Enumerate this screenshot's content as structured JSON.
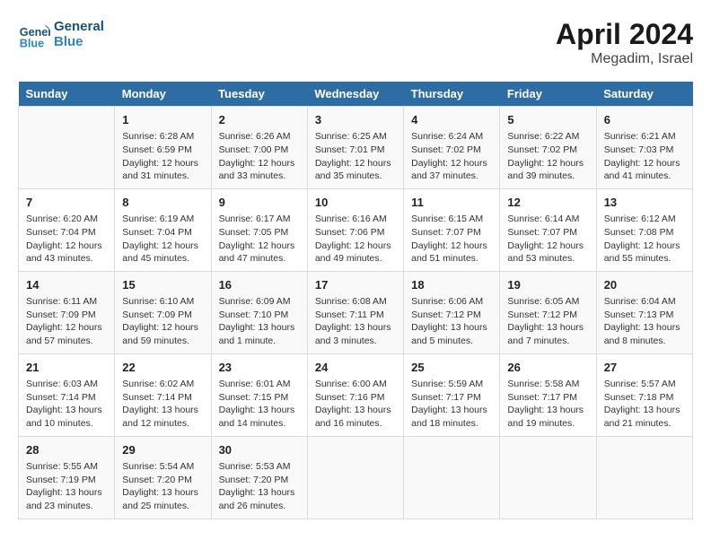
{
  "header": {
    "logo_line1": "General",
    "logo_line2": "Blue",
    "month": "April 2024",
    "location": "Megadim, Israel"
  },
  "days_of_week": [
    "Sunday",
    "Monday",
    "Tuesday",
    "Wednesday",
    "Thursday",
    "Friday",
    "Saturday"
  ],
  "weeks": [
    [
      {
        "day": "",
        "info": ""
      },
      {
        "day": "1",
        "info": "Sunrise: 6:28 AM\nSunset: 6:59 PM\nDaylight: 12 hours\nand 31 minutes."
      },
      {
        "day": "2",
        "info": "Sunrise: 6:26 AM\nSunset: 7:00 PM\nDaylight: 12 hours\nand 33 minutes."
      },
      {
        "day": "3",
        "info": "Sunrise: 6:25 AM\nSunset: 7:01 PM\nDaylight: 12 hours\nand 35 minutes."
      },
      {
        "day": "4",
        "info": "Sunrise: 6:24 AM\nSunset: 7:02 PM\nDaylight: 12 hours\nand 37 minutes."
      },
      {
        "day": "5",
        "info": "Sunrise: 6:22 AM\nSunset: 7:02 PM\nDaylight: 12 hours\nand 39 minutes."
      },
      {
        "day": "6",
        "info": "Sunrise: 6:21 AM\nSunset: 7:03 PM\nDaylight: 12 hours\nand 41 minutes."
      }
    ],
    [
      {
        "day": "7",
        "info": "Sunrise: 6:20 AM\nSunset: 7:04 PM\nDaylight: 12 hours\nand 43 minutes."
      },
      {
        "day": "8",
        "info": "Sunrise: 6:19 AM\nSunset: 7:04 PM\nDaylight: 12 hours\nand 45 minutes."
      },
      {
        "day": "9",
        "info": "Sunrise: 6:17 AM\nSunset: 7:05 PM\nDaylight: 12 hours\nand 47 minutes."
      },
      {
        "day": "10",
        "info": "Sunrise: 6:16 AM\nSunset: 7:06 PM\nDaylight: 12 hours\nand 49 minutes."
      },
      {
        "day": "11",
        "info": "Sunrise: 6:15 AM\nSunset: 7:07 PM\nDaylight: 12 hours\nand 51 minutes."
      },
      {
        "day": "12",
        "info": "Sunrise: 6:14 AM\nSunset: 7:07 PM\nDaylight: 12 hours\nand 53 minutes."
      },
      {
        "day": "13",
        "info": "Sunrise: 6:12 AM\nSunset: 7:08 PM\nDaylight: 12 hours\nand 55 minutes."
      }
    ],
    [
      {
        "day": "14",
        "info": "Sunrise: 6:11 AM\nSunset: 7:09 PM\nDaylight: 12 hours\nand 57 minutes."
      },
      {
        "day": "15",
        "info": "Sunrise: 6:10 AM\nSunset: 7:09 PM\nDaylight: 12 hours\nand 59 minutes."
      },
      {
        "day": "16",
        "info": "Sunrise: 6:09 AM\nSunset: 7:10 PM\nDaylight: 13 hours\nand 1 minute."
      },
      {
        "day": "17",
        "info": "Sunrise: 6:08 AM\nSunset: 7:11 PM\nDaylight: 13 hours\nand 3 minutes."
      },
      {
        "day": "18",
        "info": "Sunrise: 6:06 AM\nSunset: 7:12 PM\nDaylight: 13 hours\nand 5 minutes."
      },
      {
        "day": "19",
        "info": "Sunrise: 6:05 AM\nSunset: 7:12 PM\nDaylight: 13 hours\nand 7 minutes."
      },
      {
        "day": "20",
        "info": "Sunrise: 6:04 AM\nSunset: 7:13 PM\nDaylight: 13 hours\nand 8 minutes."
      }
    ],
    [
      {
        "day": "21",
        "info": "Sunrise: 6:03 AM\nSunset: 7:14 PM\nDaylight: 13 hours\nand 10 minutes."
      },
      {
        "day": "22",
        "info": "Sunrise: 6:02 AM\nSunset: 7:14 PM\nDaylight: 13 hours\nand 12 minutes."
      },
      {
        "day": "23",
        "info": "Sunrise: 6:01 AM\nSunset: 7:15 PM\nDaylight: 13 hours\nand 14 minutes."
      },
      {
        "day": "24",
        "info": "Sunrise: 6:00 AM\nSunset: 7:16 PM\nDaylight: 13 hours\nand 16 minutes."
      },
      {
        "day": "25",
        "info": "Sunrise: 5:59 AM\nSunset: 7:17 PM\nDaylight: 13 hours\nand 18 minutes."
      },
      {
        "day": "26",
        "info": "Sunrise: 5:58 AM\nSunset: 7:17 PM\nDaylight: 13 hours\nand 19 minutes."
      },
      {
        "day": "27",
        "info": "Sunrise: 5:57 AM\nSunset: 7:18 PM\nDaylight: 13 hours\nand 21 minutes."
      }
    ],
    [
      {
        "day": "28",
        "info": "Sunrise: 5:55 AM\nSunset: 7:19 PM\nDaylight: 13 hours\nand 23 minutes."
      },
      {
        "day": "29",
        "info": "Sunrise: 5:54 AM\nSunset: 7:20 PM\nDaylight: 13 hours\nand 25 minutes."
      },
      {
        "day": "30",
        "info": "Sunrise: 5:53 AM\nSunset: 7:20 PM\nDaylight: 13 hours\nand 26 minutes."
      },
      {
        "day": "",
        "info": ""
      },
      {
        "day": "",
        "info": ""
      },
      {
        "day": "",
        "info": ""
      },
      {
        "day": "",
        "info": ""
      }
    ]
  ]
}
